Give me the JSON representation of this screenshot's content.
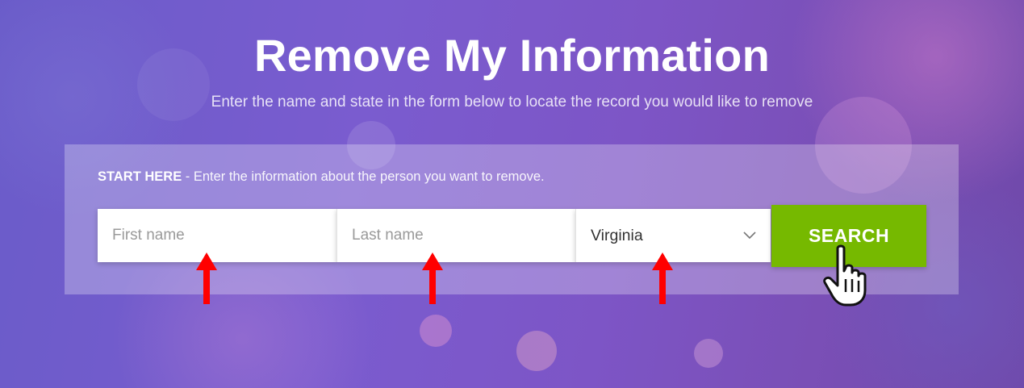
{
  "hero": {
    "title": "Remove My Information",
    "subtitle": "Enter the name and state in the form below to locate the record you would like to remove"
  },
  "form": {
    "intro_strong": "START HERE",
    "intro_text": " - Enter the information about the person you want to remove.",
    "first_name": {
      "value": "",
      "placeholder": "First name"
    },
    "last_name": {
      "value": "",
      "placeholder": "Last name"
    },
    "state": {
      "selected": "Virginia"
    },
    "search_label": "SEARCH"
  },
  "colors": {
    "accent_button": "#76b900",
    "annotation_arrow": "#ff0000"
  },
  "icons": {
    "dropdown": "chevron-down-icon",
    "pointer": "hand-cursor-icon",
    "annotation": "red-up-arrow-icon"
  }
}
